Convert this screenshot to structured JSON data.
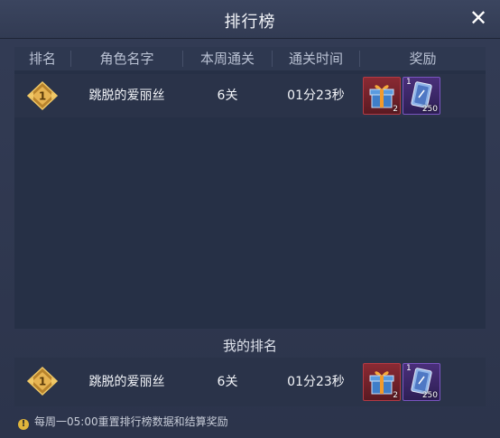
{
  "title": "排行榜",
  "close_label": "✕",
  "columns": [
    "排名",
    "角色名字",
    "本周通关",
    "通关时间",
    "奖励"
  ],
  "rows": [
    {
      "rank": "1",
      "name": "跳脱的爱丽丝",
      "cleared": "6关",
      "time": "01分23秒",
      "rewards": [
        {
          "icon": "gift-box-icon",
          "qty": "2"
        },
        {
          "icon": "card-icon",
          "level": "1",
          "qty": "250"
        }
      ]
    }
  ],
  "my_rank": {
    "label": "我的排名",
    "rank": "1",
    "name": "跳脱的爱丽丝",
    "cleared": "6关",
    "time": "01分23秒",
    "rewards": [
      {
        "icon": "gift-box-icon",
        "qty": "2"
      },
      {
        "icon": "card-icon",
        "level": "1",
        "qty": "250"
      }
    ]
  },
  "footer_note": "每周一05:00重置排行榜数据和结算奖励",
  "colors": {
    "panel_bg": "#2c344b",
    "table_bg": "#263046",
    "gold": "#d9a441"
  }
}
